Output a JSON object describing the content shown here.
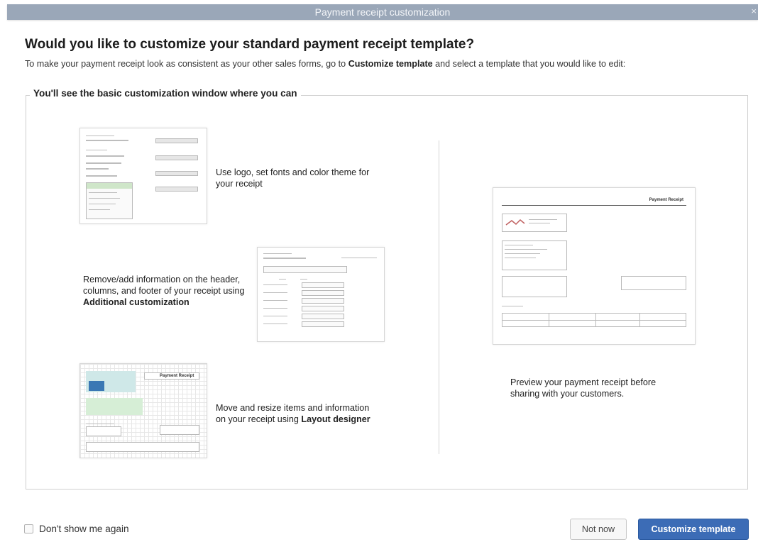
{
  "dialog": {
    "title": "Payment receipt customization",
    "close_glyph": "×",
    "headline": "Would you like to customize your standard payment receipt template?",
    "intro": {
      "before": "To make your payment receipt look as consistent as your other sales forms, go to ",
      "bold": "Customize template",
      "after": " and select a template that you would like to edit:"
    }
  },
  "section": {
    "legend": "You'll see the basic customization window where you can",
    "features": [
      {
        "icon": "basic-customization-thumbnail",
        "text": "Use logo, set fonts and color theme for your receipt"
      },
      {
        "icon": "additional-customization-thumbnail",
        "text_before": "Remove/add information on the header, columns, and footer of your receipt using ",
        "bold": "Additional customization"
      },
      {
        "icon": "layout-designer-thumbnail",
        "text_before": "Move and resize items and information on your receipt using ",
        "bold": "Layout designer"
      }
    ],
    "preview": {
      "icon": "receipt-preview-thumbnail",
      "text": "Preview your payment receipt before sharing with your customers.",
      "receipt_title": "Payment Receipt",
      "layout_title": "Payment Receipt"
    }
  },
  "footer": {
    "dont_show_label": "Don't show me again",
    "not_now_label": "Not now",
    "customize_label": "Customize template"
  },
  "colors": {
    "titlebar": "#9aa7b8",
    "primary_button": "#3c6cb6"
  }
}
